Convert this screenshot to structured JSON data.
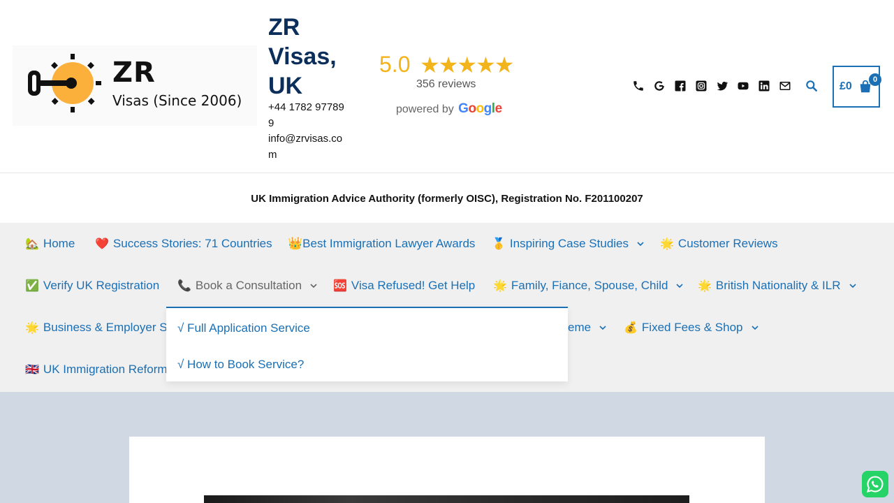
{
  "header": {
    "logo": {
      "title": "ZR",
      "subtitle": "Visas (Since 2006)"
    },
    "site_title": "ZR Visas, UK",
    "phone": "+44 1782 977899",
    "email": "info@zrvisas.com",
    "rating": {
      "score": "5.0",
      "stars": "★★★★★",
      "reviews": "356 reviews",
      "powered_by": "powered by",
      "google": [
        "G",
        "o",
        "o",
        "g",
        "l",
        "e"
      ]
    },
    "social_icons": [
      "phone-icon",
      "google-icon",
      "facebook-icon",
      "instagram-icon",
      "twitter-icon",
      "youtube-icon",
      "linkedin-icon",
      "email-icon"
    ],
    "cart": {
      "amount": "£0",
      "count": "0"
    }
  },
  "registration": "UK Immigration Advice Authority (formerly OISC), Registration No. F201100207",
  "nav": {
    "row1": [
      {
        "emoji": "🏡",
        "label": "Home"
      },
      {
        "emoji": "❤️",
        "label": "Success Stories: 71 Countries"
      },
      {
        "emoji": "",
        "label": "👑Best Immigration Lawyer Awards"
      },
      {
        "emoji": "🥇",
        "label": "Inspiring Case Studies"
      },
      {
        "emoji": "🌟",
        "label": "Customer Reviews"
      }
    ],
    "row2": [
      {
        "emoji": "✅",
        "label": "Verify UK Registration"
      },
      {
        "emoji": "📞",
        "label": "Book a Consultation"
      },
      {
        "emoji": "🆘",
        "label": "Visa Refused! Get Help"
      },
      {
        "emoji": "🌟",
        "label": "Family, Fiance, Spouse, Child"
      },
      {
        "emoji": "🌟",
        "label": "British Nationality & ILR"
      }
    ],
    "row3": [
      {
        "emoji": "🌟",
        "label": "Business & Employer Se"
      },
      {
        "emoji": "",
        "label": "eme"
      },
      {
        "emoji": "💰",
        "label": "Fixed Fees & Shop"
      }
    ],
    "row4": [
      {
        "emoji": "🇬🇧",
        "label": "UK Immigration Reforms"
      }
    ]
  },
  "dropdown": [
    "√ Full Application Service",
    "√ How to Book Service?"
  ],
  "colors": {
    "link": "#1a6fb5",
    "title": "#0b2e5b",
    "star": "#f3b31a",
    "whatsapp": "#25D366"
  }
}
